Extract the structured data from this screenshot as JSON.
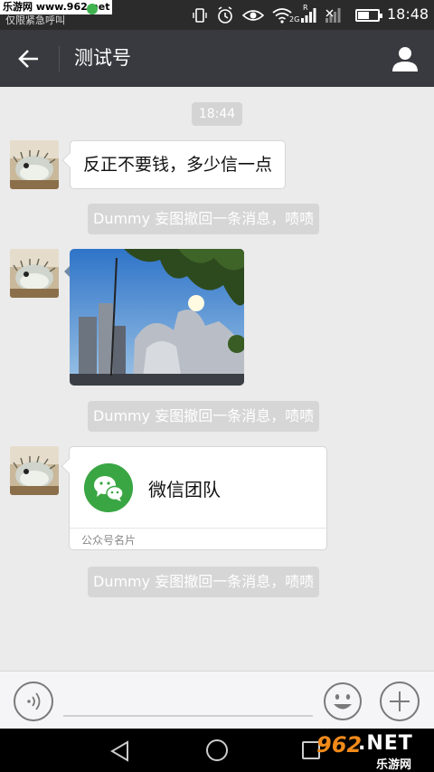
{
  "status_bar": {
    "watermark": "乐游网 www.962.net",
    "emergency": "仅限紧急呼叫",
    "network_small": "2G",
    "network_r": "R",
    "time": "18:48",
    "battery_level": 0.5,
    "icons": [
      "vibrate-icon",
      "alarm-icon",
      "eye-icon",
      "wifi-icon",
      "signal-icon",
      "no-signal-icon",
      "battery-icon"
    ]
  },
  "header": {
    "title": "测试号"
  },
  "chat": {
    "timestamp": "18:44",
    "messages": [
      {
        "type": "text",
        "text": "反正不要钱，多少信一点"
      },
      {
        "type": "system",
        "text": "Dummy 妄图撤回一条消息，啧啧"
      },
      {
        "type": "image"
      },
      {
        "type": "system",
        "text": "Dummy 妄图撤回一条消息，啧啧"
      },
      {
        "type": "card",
        "name": "微信团队",
        "footer": "公众号名片"
      },
      {
        "type": "system",
        "text": "Dummy 妄图撤回一条消息，啧啧"
      }
    ]
  },
  "input_bar": {
    "icons": [
      "voice-icon",
      "emoji-icon",
      "plus-icon"
    ]
  },
  "nav_bar": {
    "brand_number": "962",
    "brand_net": ".NET",
    "brand_sub": "乐游网"
  },
  "colors": {
    "header_bg": "#393a3f",
    "chat_bg": "#ebebeb",
    "wechat_green": "#3aa643",
    "system_note_bg": "#d6d6d6"
  }
}
